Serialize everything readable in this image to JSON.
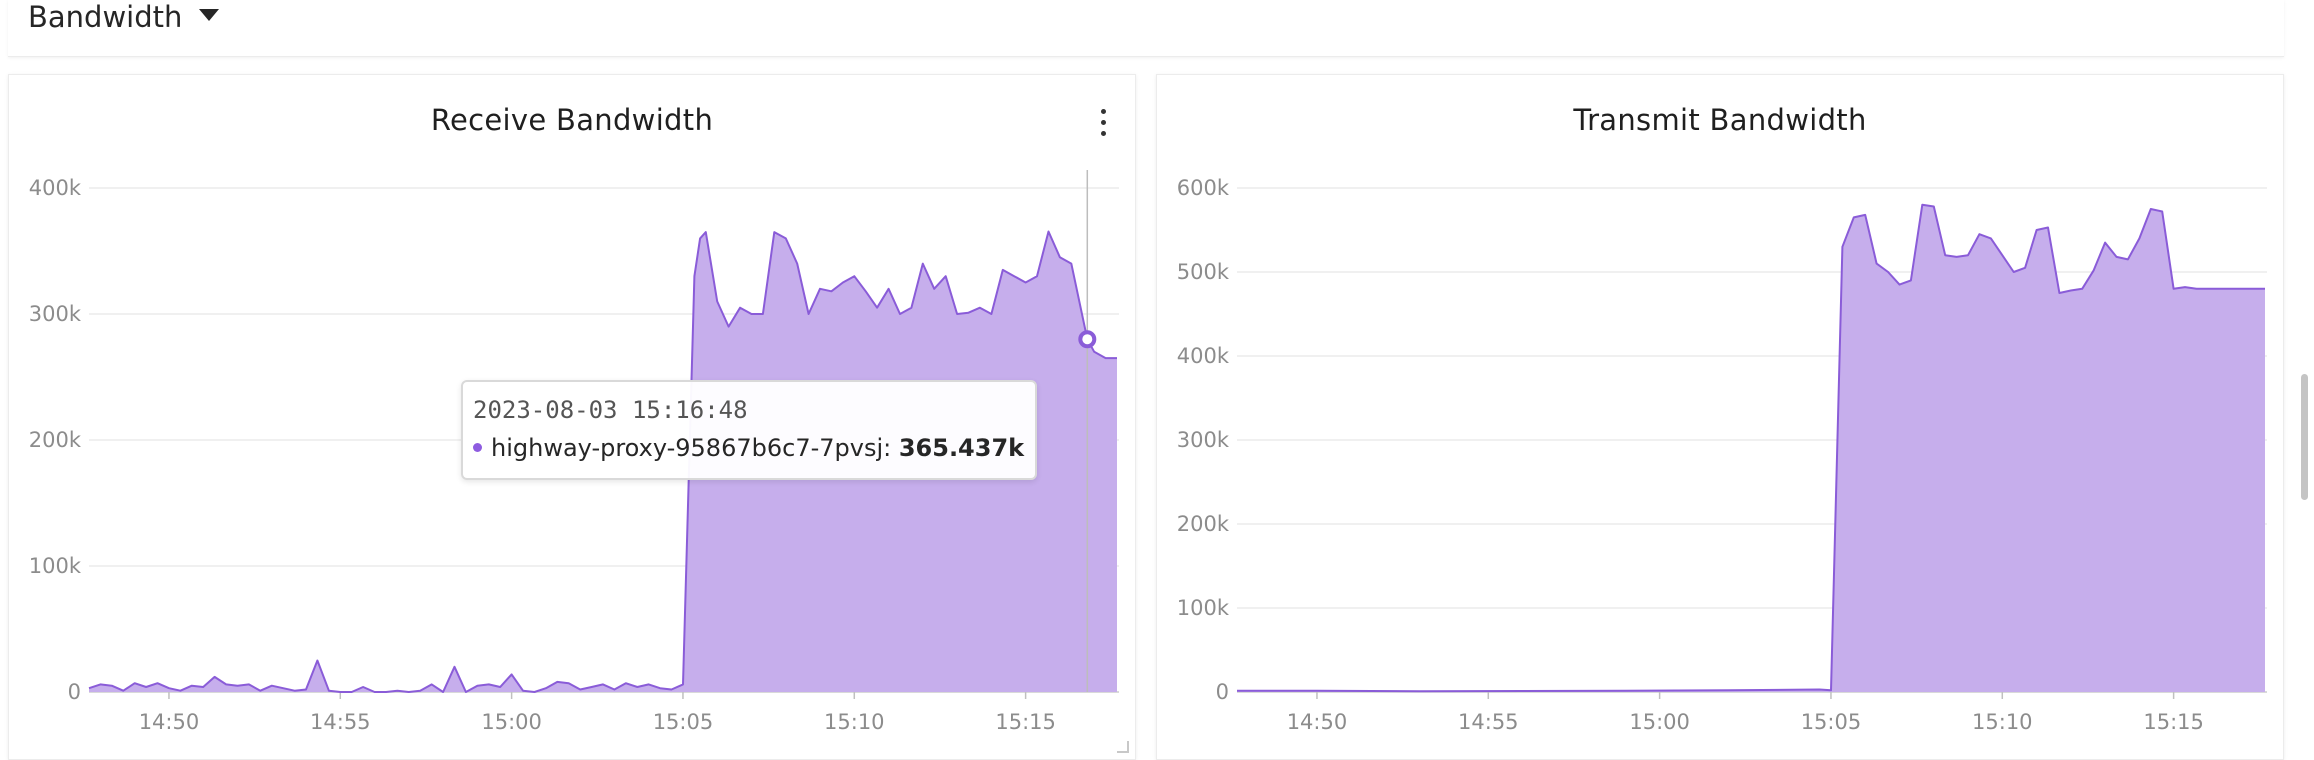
{
  "section": {
    "title": "Bandwidth",
    "caret_icon": "caret-down-icon"
  },
  "colors": {
    "series_fill": "#c6aeec",
    "series_line": "#8a5cd8",
    "grid": "#ececec",
    "crosshair": "#bdbdbd"
  },
  "panels": [
    {
      "title": "Receive Bandwidth",
      "menu_icon": "more-vertical-icon"
    },
    {
      "title": "Transmit Bandwidth"
    }
  ],
  "tooltip": {
    "time": "2023-08-03 15:16:48",
    "series": "highway-proxy-95867b6c7-7pvsj",
    "value": "365.437k"
  },
  "chart_data": [
    {
      "type": "area",
      "title": "Receive Bandwidth",
      "x_ticks": [
        "14:50",
        "14:55",
        "15:00",
        "15:05",
        "15:10",
        "15:15"
      ],
      "y_ticks": [
        "0",
        "100k",
        "200k",
        "300k",
        "400k"
      ],
      "ylim": [
        0,
        400000
      ],
      "xlim": [
        "14:47:40",
        "15:17:40"
      ],
      "grid": true,
      "series": [
        {
          "name": "highway-proxy-95867b6c7-7pvsj",
          "x": [
            "14:47:40",
            "14:48:00",
            "14:48:20",
            "14:48:40",
            "14:49:00",
            "14:49:20",
            "14:49:40",
            "14:50:00",
            "14:50:20",
            "14:50:40",
            "14:51:00",
            "14:51:20",
            "14:51:40",
            "14:52:00",
            "14:52:20",
            "14:52:40",
            "14:53:00",
            "14:53:20",
            "14:53:40",
            "14:54:00",
            "14:54:20",
            "14:54:40",
            "14:55:00",
            "14:55:20",
            "14:55:40",
            "14:56:00",
            "14:56:20",
            "14:56:40",
            "14:57:00",
            "14:57:20",
            "14:57:40",
            "14:58:00",
            "14:58:20",
            "14:58:40",
            "14:59:00",
            "14:59:20",
            "14:59:40",
            "15:00:00",
            "15:00:20",
            "15:00:40",
            "15:01:00",
            "15:01:20",
            "15:01:40",
            "15:02:00",
            "15:02:20",
            "15:02:40",
            "15:03:00",
            "15:03:20",
            "15:03:40",
            "15:04:00",
            "15:04:20",
            "15:04:40",
            "15:05:00",
            "15:05:20",
            "15:05:30",
            "15:05:40",
            "15:06:00",
            "15:06:20",
            "15:06:40",
            "15:07:00",
            "15:07:20",
            "15:07:40",
            "15:08:00",
            "15:08:20",
            "15:08:40",
            "15:09:00",
            "15:09:20",
            "15:09:40",
            "15:10:00",
            "15:10:20",
            "15:10:40",
            "15:11:00",
            "15:11:20",
            "15:11:40",
            "15:12:00",
            "15:12:20",
            "15:12:40",
            "15:13:00",
            "15:13:20",
            "15:13:40",
            "15:14:00",
            "15:14:20",
            "15:14:40",
            "15:15:00",
            "15:15:20",
            "15:15:40",
            "15:16:00",
            "15:16:20",
            "15:16:48",
            "15:17:00",
            "15:17:20",
            "15:17:40"
          ],
          "y": [
            3000,
            6000,
            5000,
            1000,
            7000,
            4000,
            7000,
            3000,
            1000,
            5000,
            4000,
            12000,
            6000,
            5000,
            6000,
            1000,
            5000,
            3000,
            1000,
            2000,
            25000,
            1000,
            0,
            0,
            4000,
            0,
            0,
            1000,
            0,
            1000,
            6000,
            0,
            20000,
            0,
            5000,
            6000,
            4000,
            14000,
            1000,
            0,
            3000,
            8000,
            7000,
            2000,
            4000,
            6000,
            2000,
            7000,
            4000,
            6000,
            3000,
            2000,
            6000,
            330000,
            360000,
            365000,
            310000,
            290000,
            305000,
            300000,
            300000,
            365000,
            360000,
            340000,
            300000,
            320000,
            318000,
            325000,
            330000,
            318000,
            305000,
            320000,
            300000,
            305000,
            340000,
            320000,
            330000,
            300000,
            301000,
            305000,
            300000,
            335000,
            330000,
            325000,
            330000,
            365437,
            345000,
            340000,
            280000,
            270000,
            265000,
            265000
          ]
        }
      ]
    },
    {
      "type": "area",
      "title": "Transmit Bandwidth",
      "x_ticks": [
        "14:50",
        "14:55",
        "15:00",
        "15:05",
        "15:10",
        "15:15"
      ],
      "y_ticks": [
        "0",
        "100k",
        "200k",
        "300k",
        "400k",
        "500k",
        "600k"
      ],
      "ylim": [
        0,
        600000
      ],
      "xlim": [
        "14:47:40",
        "15:17:40"
      ],
      "grid": true,
      "series": [
        {
          "name": "highway-proxy-95867b6c7-7pvsj",
          "x": [
            "14:47:40",
            "14:50:00",
            "14:53:00",
            "14:56:00",
            "14:59:00",
            "15:02:00",
            "15:04:40",
            "15:05:00",
            "15:05:20",
            "15:05:40",
            "15:06:00",
            "15:06:20",
            "15:06:40",
            "15:07:00",
            "15:07:20",
            "15:07:40",
            "15:08:00",
            "15:08:20",
            "15:08:40",
            "15:09:00",
            "15:09:20",
            "15:09:40",
            "15:10:00",
            "15:10:20",
            "15:10:40",
            "15:11:00",
            "15:11:20",
            "15:11:40",
            "15:12:00",
            "15:12:20",
            "15:12:40",
            "15:13:00",
            "15:13:20",
            "15:13:40",
            "15:14:00",
            "15:14:20",
            "15:14:40",
            "15:15:00",
            "15:15:20",
            "15:15:40",
            "15:16:00",
            "15:16:20",
            "15:16:40",
            "15:17:00",
            "15:17:20",
            "15:17:40"
          ],
          "y": [
            1500,
            1500,
            1000,
            1200,
            1500,
            2000,
            3000,
            2000,
            530000,
            565000,
            568000,
            510000,
            500000,
            485000,
            490000,
            580000,
            578000,
            520000,
            518000,
            520000,
            545000,
            540000,
            520000,
            500000,
            505000,
            550000,
            553000,
            475000,
            478000,
            480000,
            502000,
            535000,
            518000,
            515000,
            540000,
            575000,
            572000,
            480000,
            482000,
            480000,
            480000,
            480000,
            480000,
            480000,
            480000,
            480000
          ]
        }
      ]
    }
  ]
}
